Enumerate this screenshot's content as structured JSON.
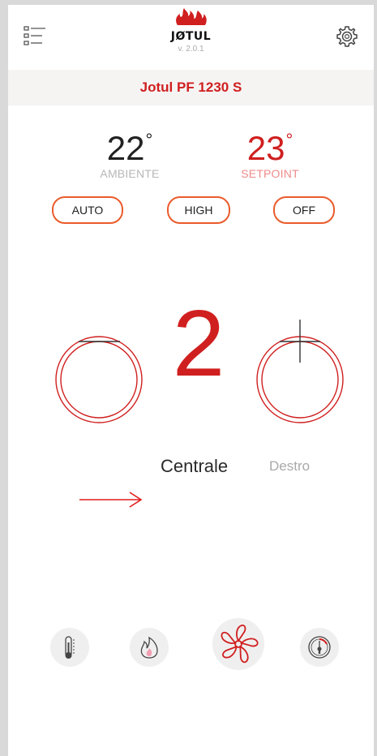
{
  "header": {
    "brand": "JØTUL",
    "version": "v. 2.0.1",
    "menu_icon": "list-menu-icon",
    "settings_icon": "gear-icon",
    "logo_icon": "flame-logo-icon"
  },
  "device": {
    "model": "Jotul PF 1230 S"
  },
  "temperatures": {
    "ambient_value": "22",
    "ambient_label": "AMBIENTE",
    "setpoint_value": "23",
    "setpoint_label": "SETPOINT",
    "degree_symbol": "°"
  },
  "modes": {
    "auto_label": "AUTO",
    "high_label": "HIGH",
    "off_label": "OFF"
  },
  "fan": {
    "level": "2",
    "minus_icon": "minus-circle-icon",
    "plus_icon": "plus-circle-icon",
    "selected_zone": "Centrale",
    "next_zone": "Destro",
    "arrow_icon": "right-arrow-icon"
  },
  "bottom_nav": {
    "items": [
      {
        "icon": "thermometer-icon"
      },
      {
        "icon": "flame-icon"
      },
      {
        "icon": "fan-icon"
      },
      {
        "icon": "gauge-icon"
      }
    ]
  },
  "colors": {
    "accent_red": "#d01f1f",
    "button_border": "#ea5b2b",
    "model_bar_bg": "#f5f4f3"
  }
}
